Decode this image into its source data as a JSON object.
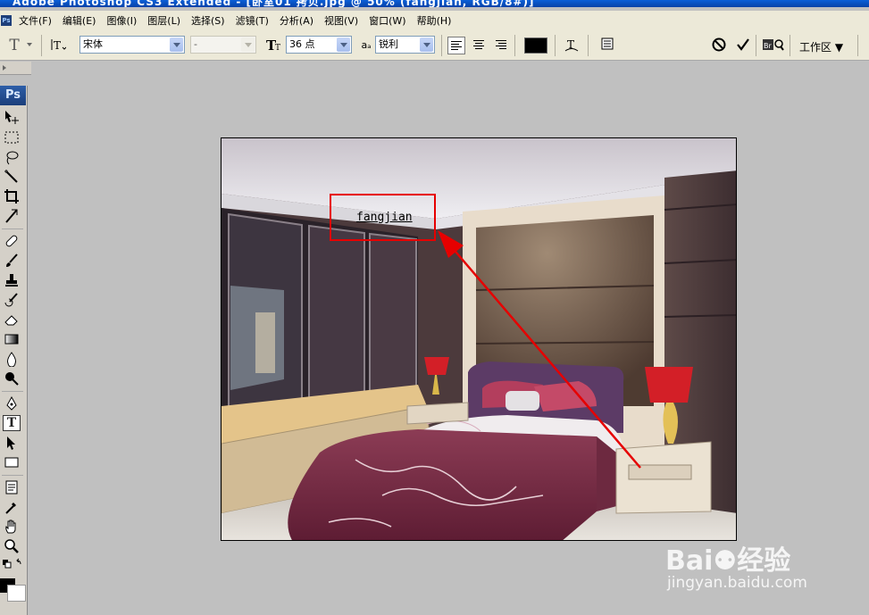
{
  "window": {
    "title": "Adobe Photoshop CS3 Extended - [卧室01 拷贝.jpg @ 50% (fangjian, RGB/8#)]"
  },
  "menu": {
    "app_icon": "Ps",
    "items": [
      "文件(F)",
      "编辑(E)",
      "图像(I)",
      "图层(L)",
      "选择(S)",
      "滤镜(T)",
      "分析(A)",
      "视图(V)",
      "窗口(W)",
      "帮助(H)"
    ]
  },
  "options": {
    "tool_icon": "type-tool-icon",
    "font_family": "宋体",
    "font_style": "-",
    "font_size": "36 点",
    "antialias_label": "aₐ",
    "antialias": "锐利",
    "text_color": "#000000",
    "workspace": "工作区 ▼",
    "bridge_label": "Br"
  },
  "toolbox": {
    "logo": "Ps",
    "active_tool": "type-tool"
  },
  "document": {
    "typed_text": "fangjian",
    "annotation_color": "#e60000"
  },
  "watermark": {
    "text": "Bai⚉经验",
    "url": "jingyan.baidu.com"
  }
}
